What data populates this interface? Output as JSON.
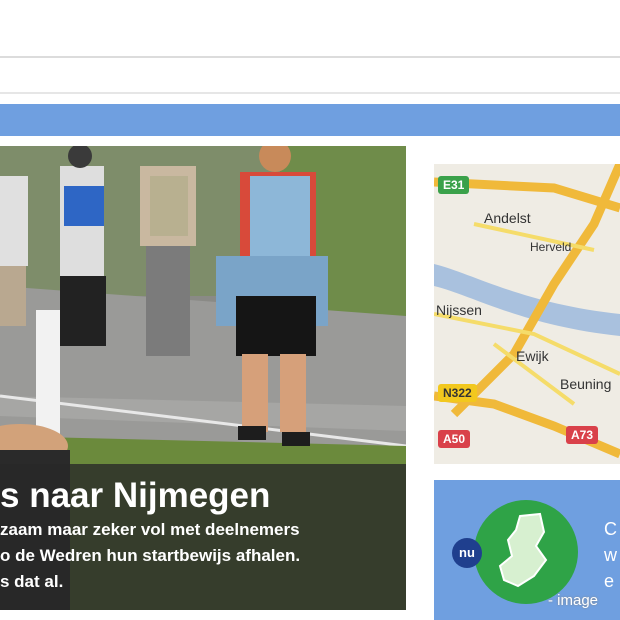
{
  "hero": {
    "title": "s naar Nijmegen",
    "lines": [
      "zaam maar zeker vol met deelnemers",
      "o de Wedren hun startbewijs afhalen.",
      "s dat al."
    ]
  },
  "map": {
    "places": [
      "Andelst",
      "Herveld",
      "Nijssen",
      "Ewijk",
      "Beuning"
    ],
    "roads": [
      "E31",
      "N322",
      "A50",
      "A73"
    ]
  },
  "promo": {
    "badge": "nu",
    "text_fragment": "C\nw\ne"
  },
  "image_label": "- image",
  "colors": {
    "accent_blue": "#6f9fe0",
    "promo_green": "#2fa347",
    "badge_navy": "#1f3f8e"
  }
}
